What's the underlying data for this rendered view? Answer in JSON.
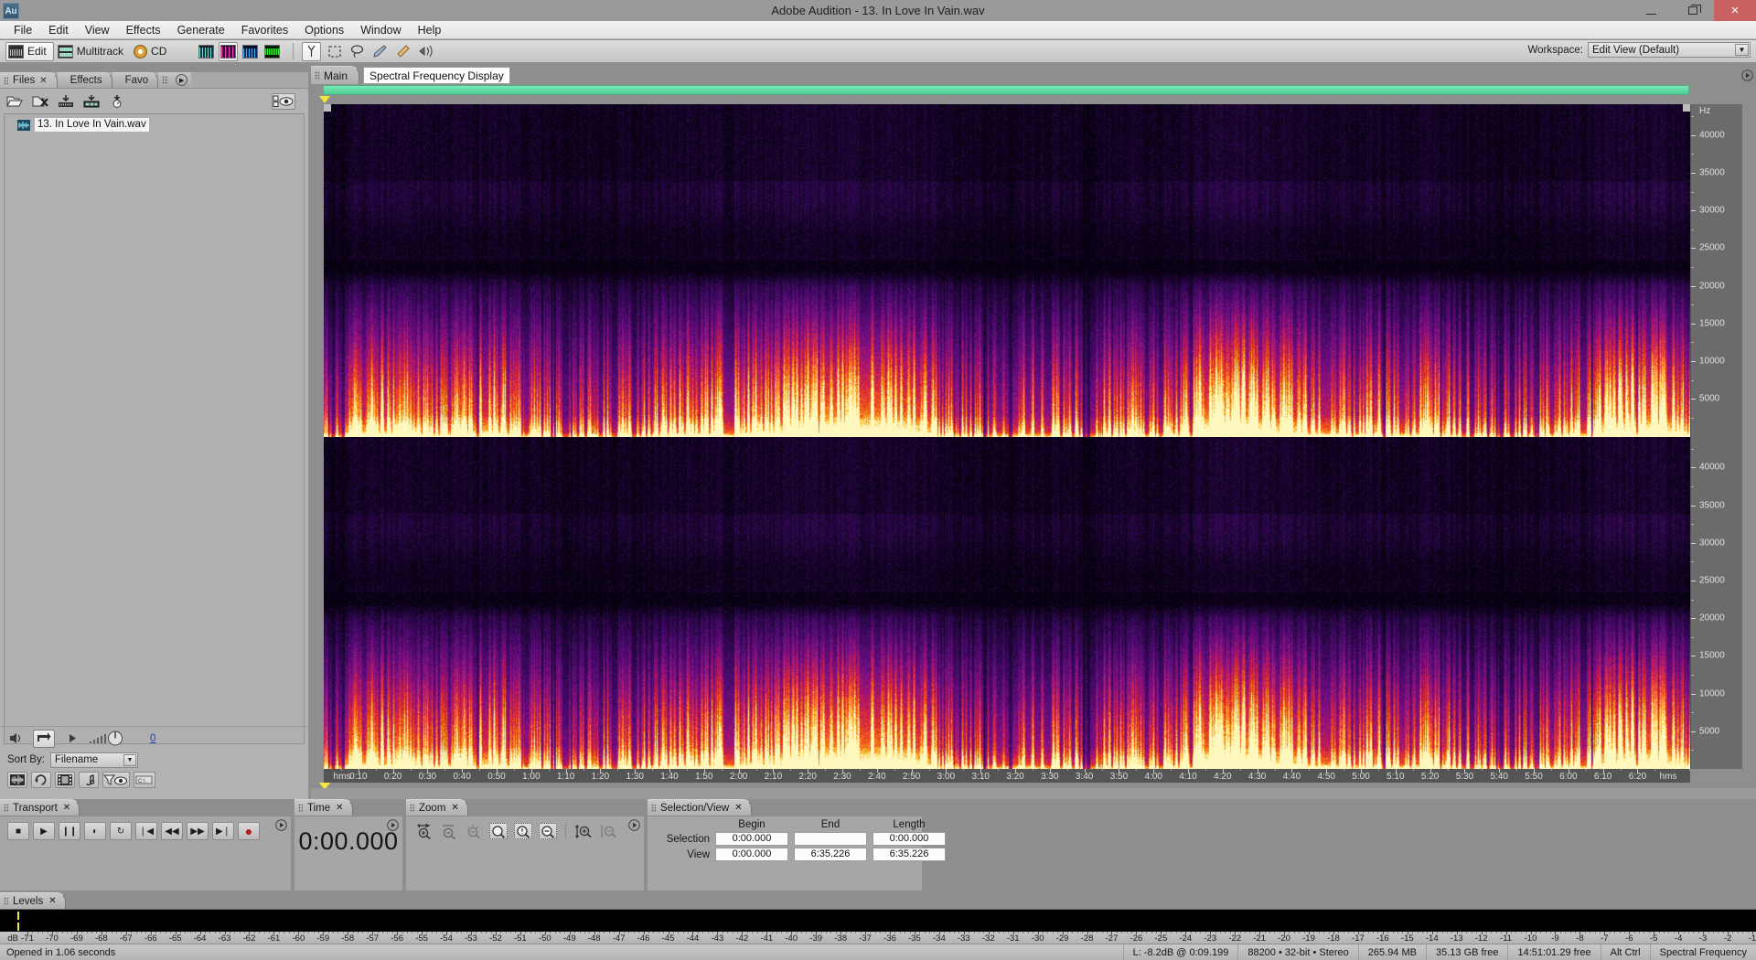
{
  "window": {
    "title": "Adobe Audition - 13. In Love In Vain.wav",
    "logo": "Au",
    "minimize": "minimize-icon",
    "maximize": "restore-icon",
    "close": "×"
  },
  "menubar": {
    "items": [
      "File",
      "Edit",
      "View",
      "Effects",
      "Generate",
      "Favorites",
      "Options",
      "Window",
      "Help"
    ]
  },
  "toolbar": {
    "modes": [
      {
        "label": "Edit",
        "icon": "waveform-icon",
        "selected": false
      },
      {
        "label": "Multitrack",
        "icon": "multitrack-icon",
        "selected": false
      },
      {
        "label": "CD",
        "icon": "cd-icon",
        "selected": false
      }
    ],
    "view_buttons": [
      {
        "icon": "waveform-view-icon",
        "selected": false
      },
      {
        "icon": "spectral-frequency-view-icon",
        "selected": true
      },
      {
        "icon": "spectral-pan-view-icon",
        "selected": false
      },
      {
        "icon": "spectral-phase-view-icon",
        "selected": false
      }
    ],
    "tools": [
      {
        "icon": "time-selection-tool-icon",
        "selected": true
      },
      {
        "icon": "marquee-selection-tool-icon",
        "selected": false
      },
      {
        "icon": "lasso-selection-tool-icon",
        "selected": false
      },
      {
        "icon": "paintbrush-selection-tool-icon",
        "selected": false
      },
      {
        "icon": "spot-healing-brush-tool-icon",
        "selected": false
      },
      {
        "icon": "effects-paintbrush-tool-icon",
        "selected": false
      }
    ],
    "workspace_label": "Workspace:",
    "workspace_value": "Edit View (Default)"
  },
  "files_panel": {
    "tabs": [
      {
        "label": "Files",
        "closable": true,
        "active": true
      },
      {
        "label": "Effects",
        "closable": false,
        "active": false
      },
      {
        "label": "Favo",
        "closable": false,
        "active": false
      }
    ],
    "toolbar_icons": [
      "open-file-icon",
      "close-file-icon",
      "insert-into-multitrack-icon",
      "insert-into-cd-list-icon",
      "metronome-icon",
      "show-hide-columns-icon"
    ],
    "files": [
      {
        "name": "13. In Love In Vain.wav",
        "icon": "wav-file-icon",
        "selected": true
      }
    ],
    "transport_icons": [
      "speaker-icon",
      "loop-play-icon",
      "play-icon",
      "volume-slider-icon"
    ],
    "volume_value": "0",
    "sort_by_label": "Sort By:",
    "sort_by_value": "Filename",
    "bottom_icons": [
      "show-waveform-files-icon",
      "show-loop-files-icon",
      "show-video-files-icon",
      "show-midi-files-icon",
      "filter-view-icon",
      "show-full-paths-icon"
    ]
  },
  "editor": {
    "tabs": [
      {
        "label": "Main",
        "active": true
      }
    ],
    "tooltip": "Spectral Frequency Display",
    "freq_axis_unit": "Hz",
    "freq_ticks": [
      40000,
      35000,
      30000,
      25000,
      20000,
      15000,
      10000,
      5000
    ],
    "freq_max": 44100,
    "time_axis_unit": "hms",
    "time_ticks": [
      "0:10",
      "0:20",
      "0:30",
      "0:40",
      "0:50",
      "1:00",
      "1:10",
      "1:20",
      "1:30",
      "1:40",
      "1:50",
      "2:00",
      "2:10",
      "2:20",
      "2:30",
      "2:40",
      "2:50",
      "3:00",
      "3:10",
      "3:20",
      "3:30",
      "3:40",
      "3:50",
      "4:00",
      "4:10",
      "4:20",
      "4:30",
      "4:40",
      "4:50",
      "5:00",
      "5:10",
      "5:20",
      "5:30",
      "5:40",
      "5:50",
      "6:00",
      "6:10",
      "6:20"
    ],
    "channels": 2
  },
  "transport_panel": {
    "tab": "Transport",
    "buttons": [
      {
        "name": "stop-button",
        "glyph": "■"
      },
      {
        "name": "play-button",
        "glyph": "▶"
      },
      {
        "name": "pause-button",
        "glyph": "❙❙"
      },
      {
        "name": "play-from-cursor-to-end-button",
        "glyph": "◐"
      },
      {
        "name": "loop-play-button",
        "glyph": "↻"
      },
      {
        "name": "go-to-beginning-button",
        "glyph": "❘◀"
      },
      {
        "name": "rewind-button",
        "glyph": "◀◀"
      },
      {
        "name": "fast-forward-button",
        "glyph": "▶▶"
      },
      {
        "name": "go-to-end-button",
        "glyph": "▶❘"
      },
      {
        "name": "record-button",
        "glyph": "●"
      }
    ]
  },
  "time_panel": {
    "tab": "Time",
    "value": "0:00.000"
  },
  "zoom_panel": {
    "tab": "Zoom",
    "buttons": [
      "zoom-in-horizontally-icon",
      "zoom-out-horizontally-icon",
      "zoom-out-full-both-axes-icon",
      "zoom-to-selection-icon",
      "zoom-in-to-left-edge-of-selection-icon",
      "zoom-in-to-right-edge-of-selection-icon",
      "zoom-in-vertically-icon",
      "zoom-out-vertically-icon"
    ]
  },
  "selection_view_panel": {
    "tab": "Selection/View",
    "headers": [
      "Begin",
      "End",
      "Length"
    ],
    "rows": [
      {
        "label": "Selection",
        "begin": "0:00.000",
        "end": "",
        "length": "0:00.000"
      },
      {
        "label": "View",
        "begin": "0:00.000",
        "end": "6:35.226",
        "length": "6:35.226"
      }
    ]
  },
  "levels_panel": {
    "tab": "Levels",
    "unit": "dB",
    "scale": [
      -71,
      -70,
      -69,
      -68,
      -67,
      -66,
      -65,
      -64,
      -63,
      -62,
      -61,
      -60,
      -59,
      -58,
      -57,
      -56,
      -55,
      -54,
      -53,
      -52,
      -51,
      -50,
      -49,
      -48,
      -47,
      -46,
      -45,
      -44,
      -43,
      -42,
      -41,
      -40,
      -39,
      -38,
      -37,
      -36,
      -35,
      -34,
      -33,
      -32,
      -31,
      -30,
      -29,
      -28,
      -27,
      -26,
      -25,
      -24,
      -23,
      -22,
      -21,
      -20,
      -19,
      -18,
      -17,
      -16,
      -15,
      -14,
      -13,
      -12,
      -11,
      -10,
      -9,
      -8,
      -7,
      -6,
      -5,
      -4,
      -3,
      -2,
      -1
    ]
  },
  "statusbar": {
    "message": "Opened in 1.06 seconds",
    "cells": [
      "L: -8.2dB @   0:09.199",
      "88200 • 32-bit • Stereo",
      "265.94 MB",
      "35.13 GB free",
      "14:51:01.29 free",
      "Alt Ctrl",
      "Spectral Frequency"
    ]
  },
  "colors": {
    "accent_green": "#5fd9a0",
    "marker_yellow": "#f5e53c",
    "close_red": "#c9625f",
    "chrome": "#b3b3b3"
  }
}
